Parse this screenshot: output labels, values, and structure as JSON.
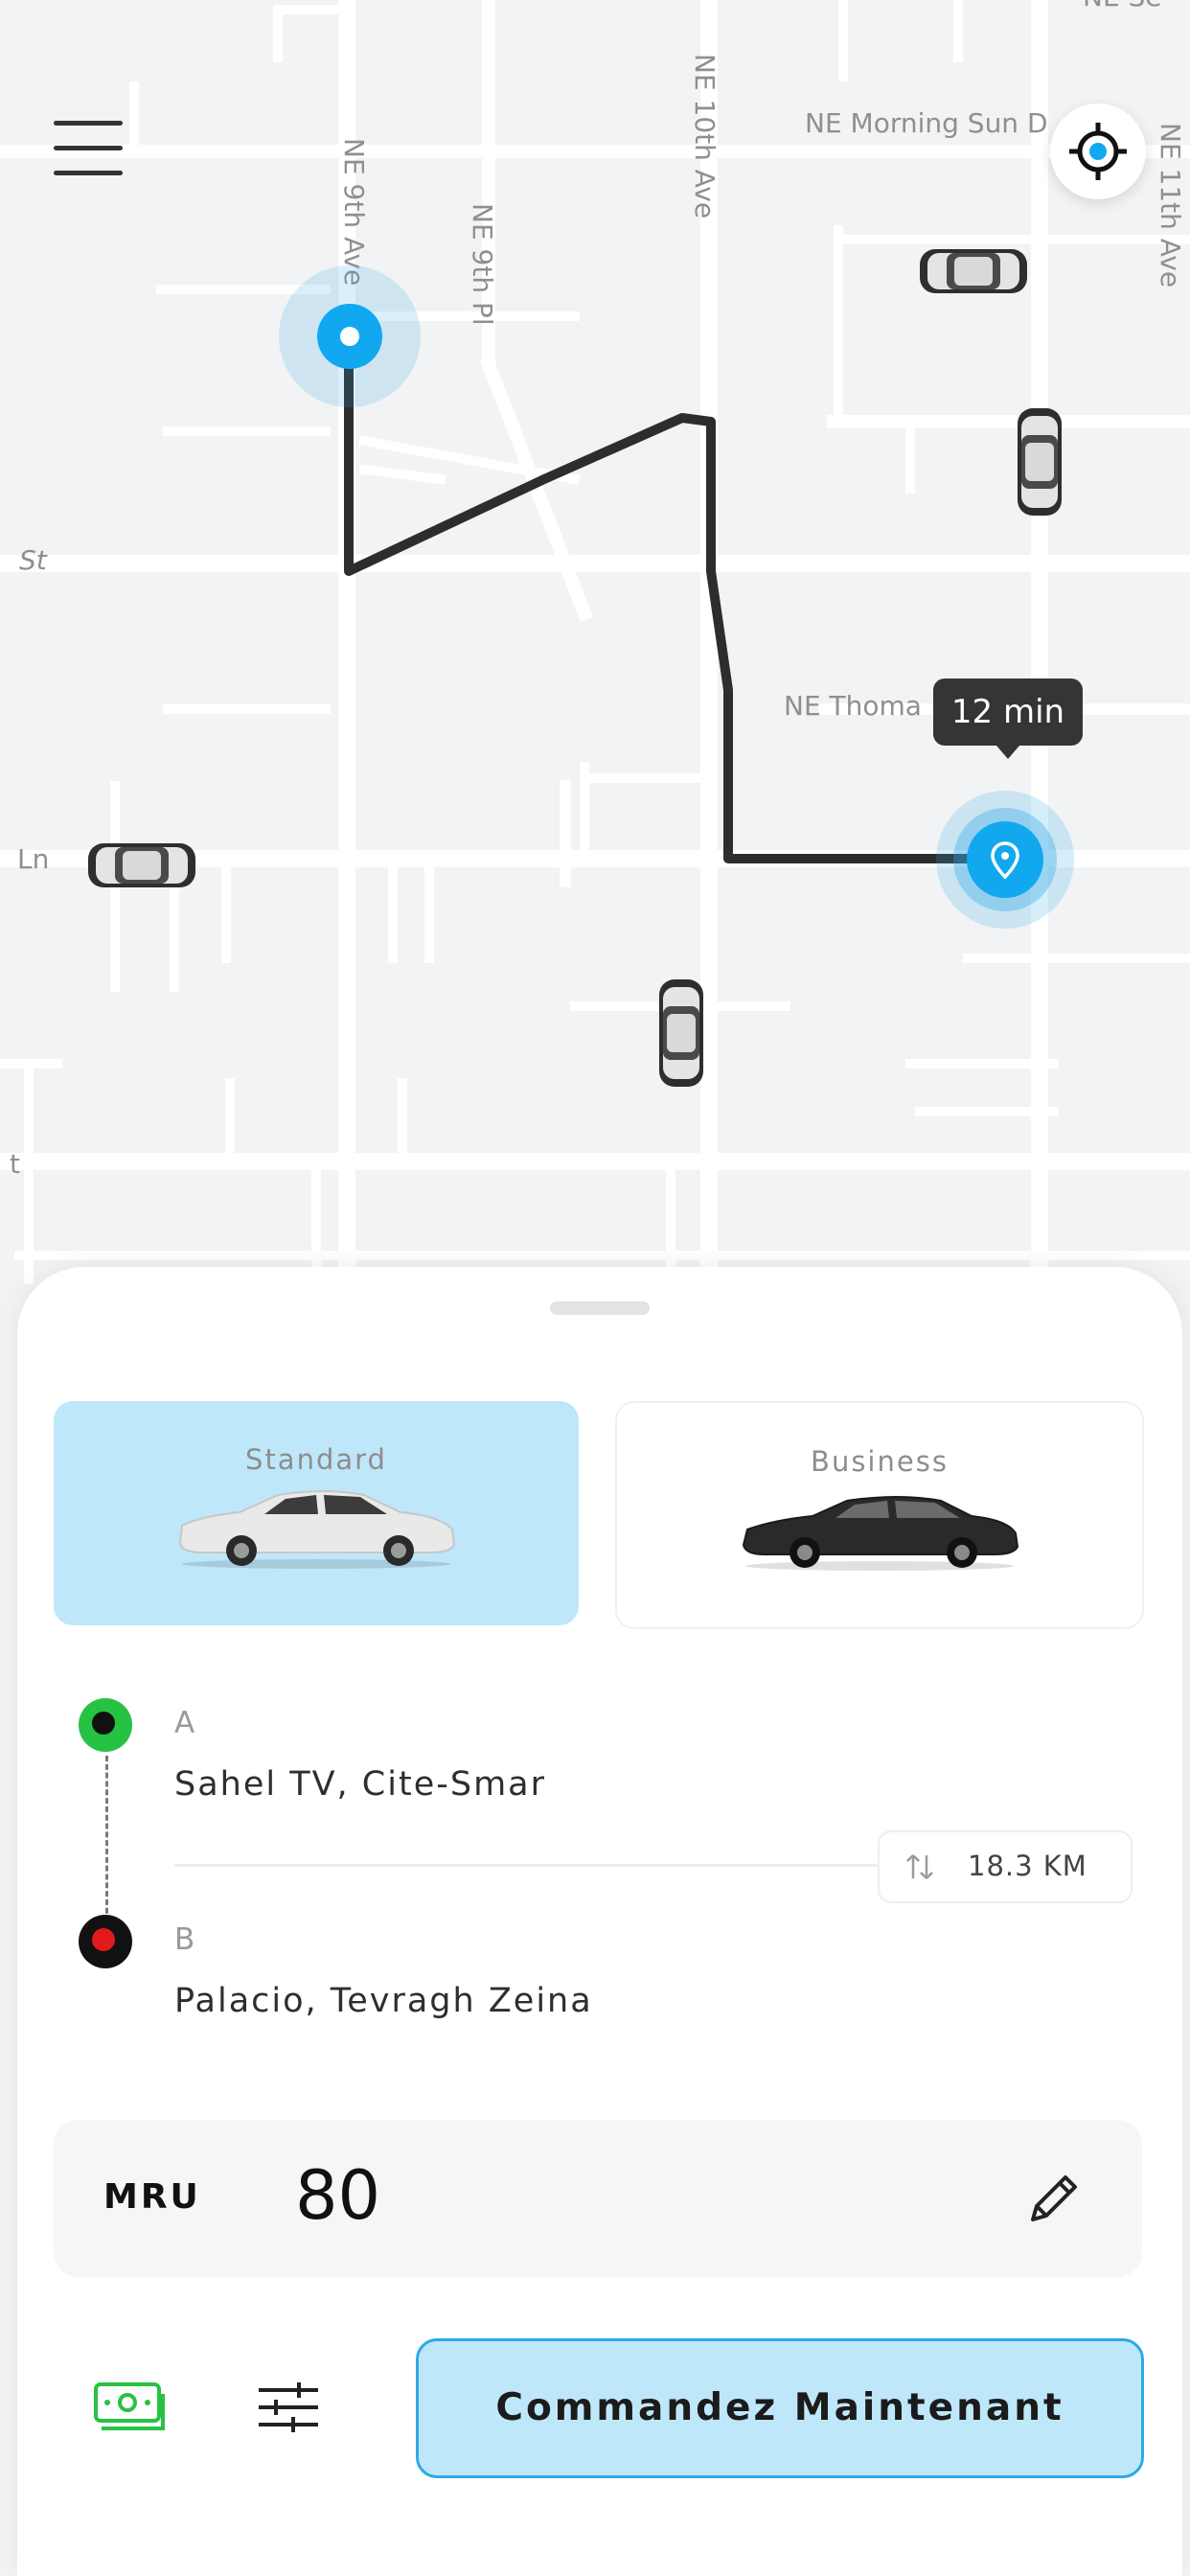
{
  "map": {
    "streets": {
      "ne_9th_ave": "NE 9th Ave",
      "ne_9th_pl": "NE 9th Pl",
      "ne_10th_ave": "NE 10th Ave",
      "ne_morning_sun": "NE Morning Sun D",
      "ne_11th_ave": "NE 11th Ave",
      "ne_thomas": "NE Thoma",
      "st": "St",
      "ln": "Ln",
      "t": "t",
      "ne_sec": "NE Se"
    },
    "eta": "12 min"
  },
  "ride_options": [
    {
      "label": "Standard",
      "selected": true,
      "car_color": "#e9e9e9"
    },
    {
      "label": "Business",
      "selected": false,
      "car_color": "#2a2a2a"
    }
  ],
  "route": {
    "origin": {
      "marker": "A",
      "address": "Sahel TV, Cite-Smar",
      "color": "#27c244"
    },
    "destination": {
      "marker": "B",
      "address": "Palacio, Tevragh Zeina",
      "color": "#e11b1b"
    },
    "distance": "18.3 KM"
  },
  "fare": {
    "currency": "MRU",
    "amount": "80"
  },
  "actions": {
    "order_label": "Commandez Maintenant"
  },
  "colors": {
    "accent": "#2ea9e6",
    "accent_light": "#bfe7fa",
    "route": "#2d2d2d",
    "cash_icon": "#27c244"
  }
}
